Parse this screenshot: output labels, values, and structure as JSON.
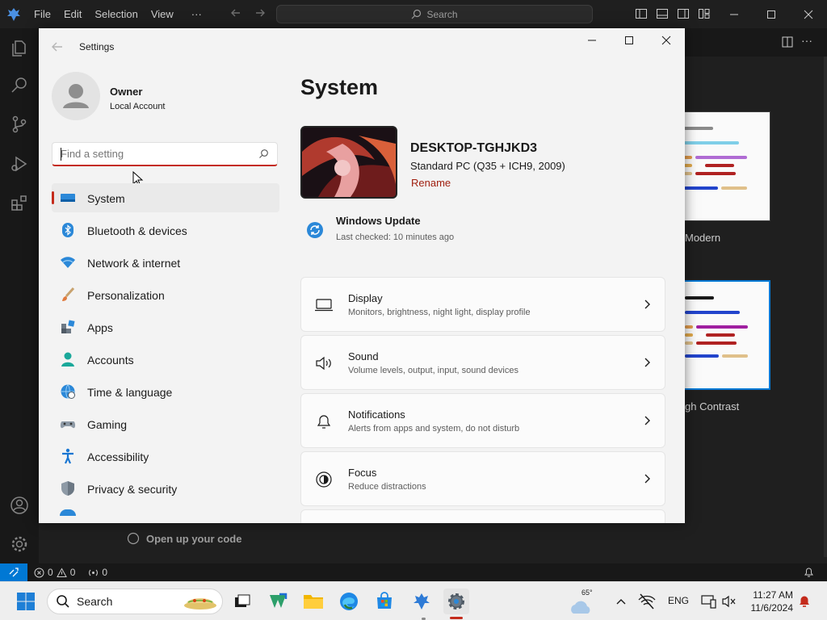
{
  "vscode": {
    "menu": [
      "File",
      "Edit",
      "Selection",
      "View",
      "···"
    ],
    "search_placeholder": "Search",
    "open_code_label": "Open up your code",
    "theme_labels": [
      "Modern",
      "gh Contrast"
    ],
    "status": {
      "errors": "0",
      "warnings": "0",
      "ports": "0"
    },
    "accent": "#0078d4"
  },
  "settings": {
    "window_title": "Settings",
    "user": {
      "name": "Owner",
      "account_type": "Local Account"
    },
    "search_placeholder": "Find a setting",
    "nav": [
      {
        "label": "System",
        "icon": "system-icon",
        "active": true
      },
      {
        "label": "Bluetooth & devices",
        "icon": "bluetooth-icon"
      },
      {
        "label": "Network & internet",
        "icon": "wifi-icon"
      },
      {
        "label": "Personalization",
        "icon": "brush-icon"
      },
      {
        "label": "Apps",
        "icon": "apps-icon"
      },
      {
        "label": "Accounts",
        "icon": "person-icon"
      },
      {
        "label": "Time & language",
        "icon": "globe-clock-icon"
      },
      {
        "label": "Gaming",
        "icon": "gamepad-icon"
      },
      {
        "label": "Accessibility",
        "icon": "accessibility-icon"
      },
      {
        "label": "Privacy & security",
        "icon": "shield-icon"
      }
    ],
    "page_title": "System",
    "device": {
      "name": "DESKTOP-TGHJKD3",
      "model": "Standard PC (Q35 + ICH9, 2009)",
      "rename_label": "Rename"
    },
    "update": {
      "title": "Windows Update",
      "subtitle": "Last checked: 10 minutes ago"
    },
    "cards": [
      {
        "title": "Display",
        "desc": "Monitors, brightness, night light, display profile",
        "icon": "monitor-icon"
      },
      {
        "title": "Sound",
        "desc": "Volume levels, output, input, sound devices",
        "icon": "speaker-icon"
      },
      {
        "title": "Notifications",
        "desc": "Alerts from apps and system, do not disturb",
        "icon": "bell-icon"
      },
      {
        "title": "Focus",
        "desc": "Reduce distractions",
        "icon": "focus-icon"
      }
    ],
    "accent": "#c42b1c"
  },
  "taskbar": {
    "search_label": "Search",
    "weather_temp": "65°",
    "language": "ENG",
    "time": "11:27 AM",
    "date": "11/6/2024"
  }
}
